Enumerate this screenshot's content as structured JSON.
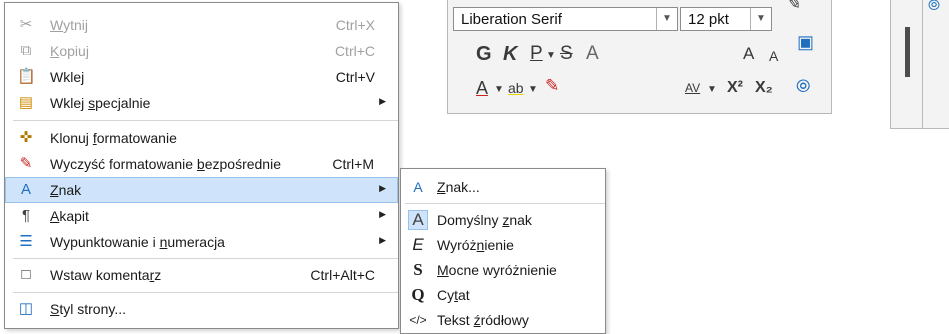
{
  "toolbar": {
    "font_name": "Liberation Serif",
    "font_size": "12 pkt",
    "btn_bold": "G",
    "btn_italic": "K",
    "btn_underline": "P",
    "btn_strike": "S",
    "btn_outline": "A",
    "btn_grow": "A",
    "btn_shrink": "A",
    "btn_fontcolor": "A",
    "btn_highlight": "ab",
    "btn_spacing": "AV",
    "btn_super": "X²",
    "btn_sub": "X₂"
  },
  "menu": {
    "items": [
      {
        "pre": "",
        "u": "W",
        "post": "ytnij",
        "shortcut": "Ctrl+X"
      },
      {
        "pre": "",
        "u": "K",
        "post": "opiuj",
        "shortcut": "Ctrl+C"
      },
      {
        "pre": "Wkle",
        "u": "j",
        "post": "",
        "shortcut": "Ctrl+V"
      },
      {
        "pre": "Wklej ",
        "u": "s",
        "post": "pecjalnie",
        "shortcut": ""
      },
      {
        "pre": "Klonuj ",
        "u": "f",
        "post": "ormatowanie",
        "shortcut": ""
      },
      {
        "pre": "Wyczyść formatowanie ",
        "u": "b",
        "post": "ezpośrednie",
        "shortcut": "Ctrl+M"
      },
      {
        "pre": "",
        "u": "Z",
        "post": "nak",
        "shortcut": ""
      },
      {
        "pre": "",
        "u": "A",
        "post": "kapit",
        "shortcut": ""
      },
      {
        "pre": "Wypunktowanie i ",
        "u": "n",
        "post": "umeracja",
        "shortcut": ""
      },
      {
        "pre": "Wstaw komenta",
        "u": "r",
        "post": "z",
        "shortcut": "Ctrl+Alt+C"
      },
      {
        "pre": "",
        "u": "S",
        "post": "tyl strony...",
        "shortcut": ""
      }
    ]
  },
  "submenu": {
    "items": [
      {
        "icon": "A",
        "pre": "",
        "u": "Z",
        "post": "nak..."
      },
      {
        "icon": "A",
        "pre": "Domyślny ",
        "u": "z",
        "post": "nak"
      },
      {
        "icon": "E",
        "pre": "Wyróż",
        "u": "n",
        "post": "ienie"
      },
      {
        "icon": "S",
        "pre": "",
        "u": "M",
        "post": "ocne wyróżnienie"
      },
      {
        "icon": "Q",
        "pre": "Cy",
        "u": "t",
        "post": "at"
      },
      {
        "icon": "</>",
        "pre": "Tekst ",
        "u": "ź",
        "post": "ródłowy"
      }
    ]
  }
}
